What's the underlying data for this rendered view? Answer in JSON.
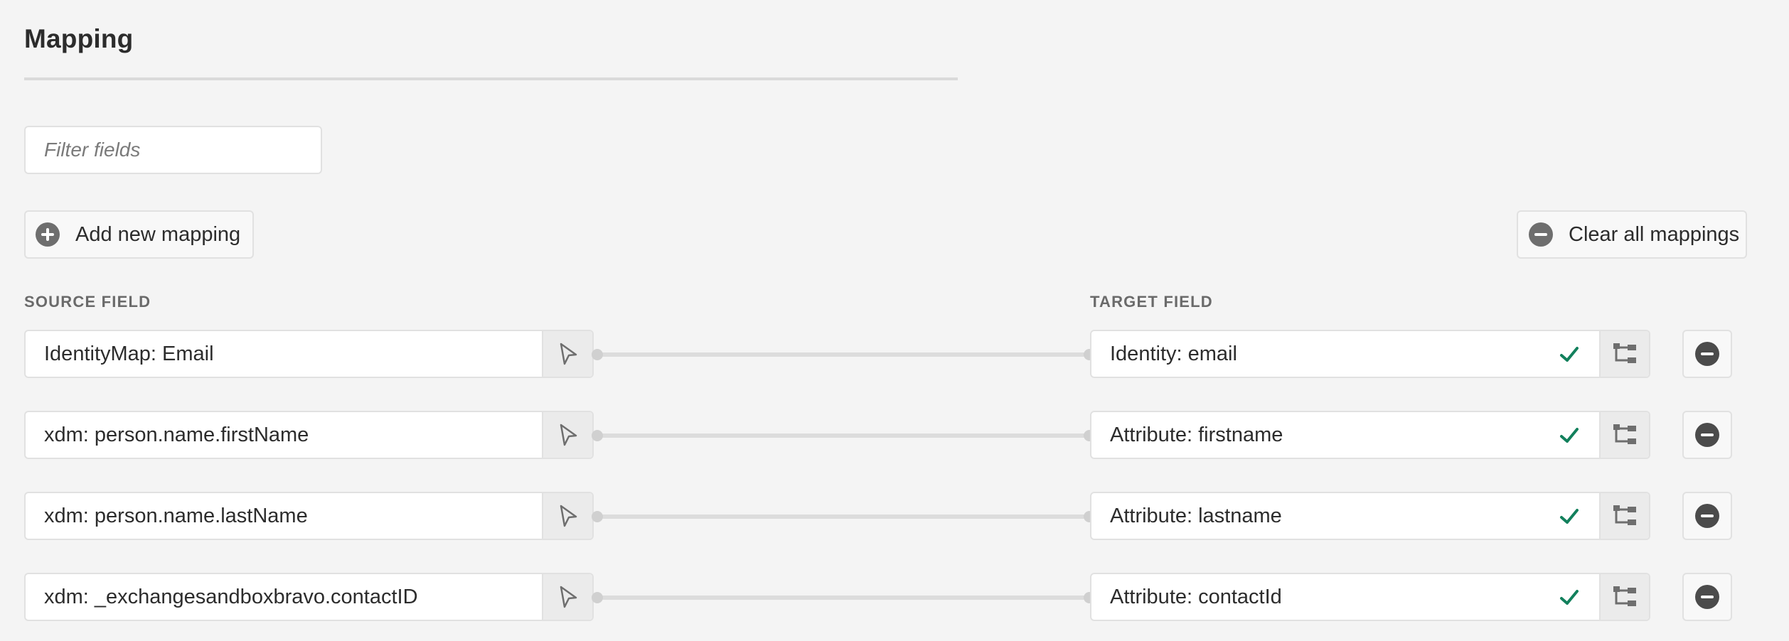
{
  "page": {
    "title": "Mapping"
  },
  "filter": {
    "placeholder": "Filter fields",
    "value": ""
  },
  "toolbar": {
    "add_label": "Add new mapping",
    "add_icon": "add-circle-icon",
    "clear_label": "Clear all mappings",
    "clear_icon": "remove-circle-icon"
  },
  "columns": {
    "source": "SOURCE FIELD",
    "target": "TARGET FIELD"
  },
  "colors": {
    "background": "#f4f4f4",
    "check": "#12805c",
    "icon_gray": "#6e6e6e",
    "border": "#e1e1e1"
  },
  "mappings": [
    {
      "source": "IdentityMap: Email",
      "target": "Identity: email",
      "valid": true
    },
    {
      "source": "xdm: person.name.firstName",
      "target": "Attribute: firstname",
      "valid": true
    },
    {
      "source": "xdm: person.name.lastName",
      "target": "Attribute: lastname",
      "valid": true
    },
    {
      "source": "xdm: _exchangesandboxbravo.contactID",
      "target": "Attribute: contactId",
      "valid": true
    }
  ]
}
